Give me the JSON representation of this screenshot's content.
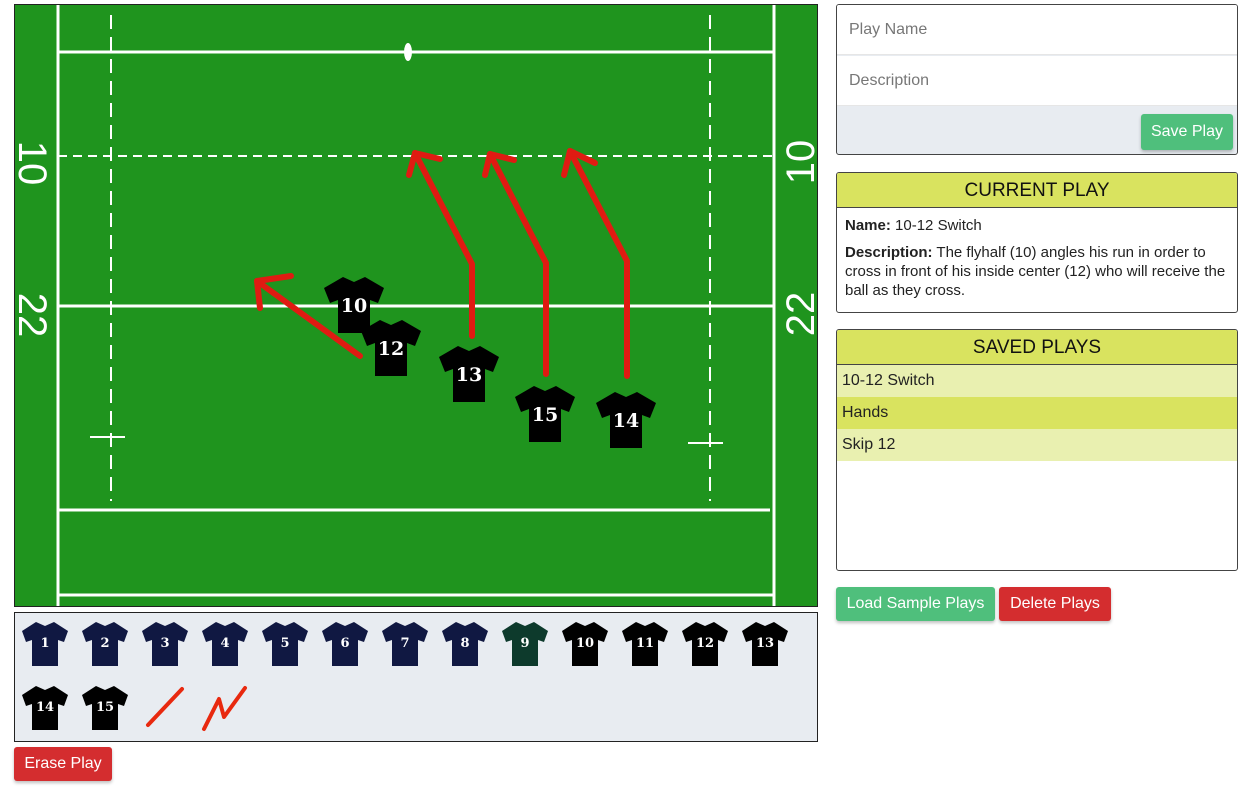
{
  "field": {
    "yard_markers": {
      "left_top": "10",
      "left_bottom": "22",
      "right_top": "10",
      "right_bottom": "22"
    },
    "players": [
      {
        "number": "10",
        "color": "#000000"
      },
      {
        "number": "12",
        "color": "#000000"
      },
      {
        "number": "13",
        "color": "#000000"
      },
      {
        "number": "15",
        "color": "#000000"
      },
      {
        "number": "14",
        "color": "#000000"
      }
    ],
    "run_line_color": "#e01b12"
  },
  "palette": {
    "jerseys": [
      {
        "number": "1",
        "color": "#101842"
      },
      {
        "number": "2",
        "color": "#101842"
      },
      {
        "number": "3",
        "color": "#101842"
      },
      {
        "number": "4",
        "color": "#101842"
      },
      {
        "number": "5",
        "color": "#101842"
      },
      {
        "number": "6",
        "color": "#101842"
      },
      {
        "number": "7",
        "color": "#101842"
      },
      {
        "number": "8",
        "color": "#101842"
      },
      {
        "number": "9",
        "color": "#0d3a2c"
      },
      {
        "number": "10",
        "color": "#000000"
      },
      {
        "number": "11",
        "color": "#000000"
      },
      {
        "number": "12",
        "color": "#000000"
      },
      {
        "number": "13",
        "color": "#000000"
      },
      {
        "number": "14",
        "color": "#000000"
      },
      {
        "number": "15",
        "color": "#000000"
      }
    ],
    "tools": [
      "straight-line-icon",
      "zigzag-line-icon"
    ]
  },
  "buttons": {
    "erase": "Erase Play",
    "save": "Save Play",
    "load_samples": "Load Sample Plays",
    "delete": "Delete Plays"
  },
  "form": {
    "name_placeholder": "Play Name",
    "description_placeholder": "Description"
  },
  "current_play": {
    "heading": "CURRENT PLAY",
    "name_label": "Name:",
    "name": "10-12 Switch",
    "description_label": "Description:",
    "description": "The flyhalf (10) angles his run in order to cross in front of his inside center (12) who will receive the ball as they cross."
  },
  "saved_plays": {
    "heading": "SAVED PLAYS",
    "items": [
      "10-12 Switch",
      "Hands",
      "Skip 12"
    ]
  },
  "colors": {
    "pitch": "#1f941e",
    "accent_yellow": "#d9e35f",
    "row_light": "#e9f0b0",
    "row_dark": "#d9e35f",
    "green_button": "#4fbf7c",
    "red_button": "#d42d2f"
  }
}
